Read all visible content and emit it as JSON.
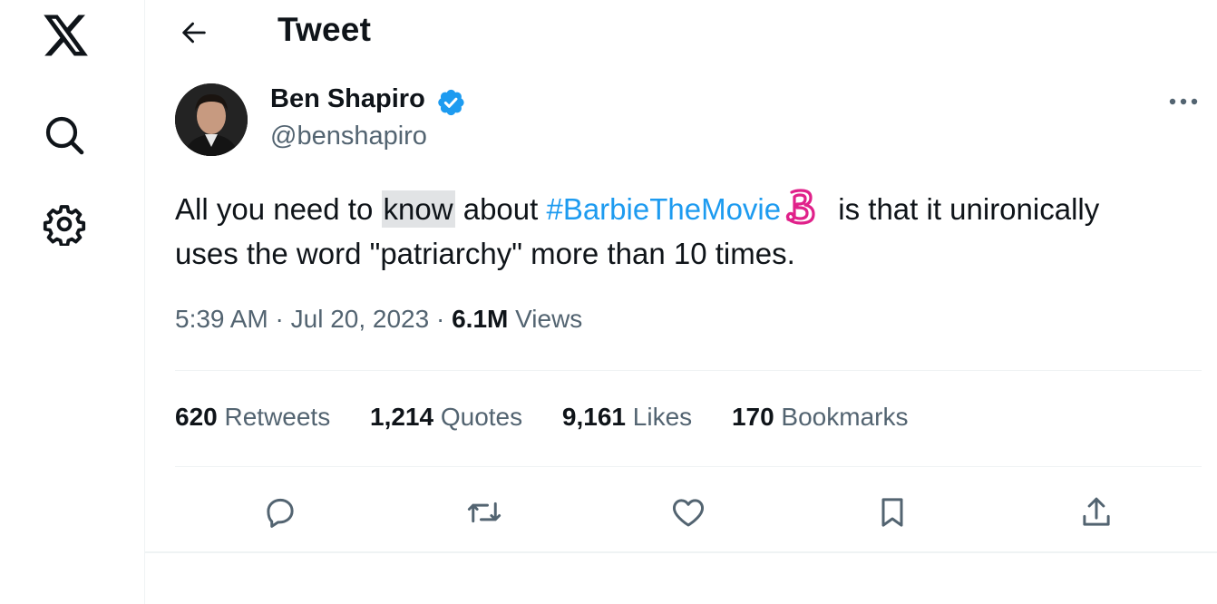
{
  "nav": {
    "items": [
      {
        "name": "x-logo-icon"
      },
      {
        "name": "search-icon"
      },
      {
        "name": "settings-gear-icon"
      }
    ]
  },
  "header": {
    "title": "Tweet"
  },
  "author": {
    "name": "Ben Shapiro",
    "handle": "@benshapiro",
    "verified": true
  },
  "tweet": {
    "text_part1": "All you need to ",
    "text_highlight": "know",
    "text_part2": " about ",
    "hashtag": "#BarbieTheMovie",
    "text_part3": " is that it unironically",
    "line2": "uses the word \"patriarchy\" more than 10 times."
  },
  "meta": {
    "time": "5:39 AM",
    "date": "Jul 20, 2023",
    "sep": " · ",
    "views_count": "6.1M",
    "views_label": " Views"
  },
  "stats": [
    {
      "count": "620",
      "label": " Retweets"
    },
    {
      "count": "1,214",
      "label": " Quotes"
    },
    {
      "count": "9,161",
      "label": " Likes"
    },
    {
      "count": "170",
      "label": " Bookmarks"
    }
  ],
  "colors": {
    "text": "#0f1419",
    "secondary": "#536471",
    "accent": "#1d9bf0",
    "divider": "#eff3f4",
    "barbie_pink": "#e0218a"
  }
}
